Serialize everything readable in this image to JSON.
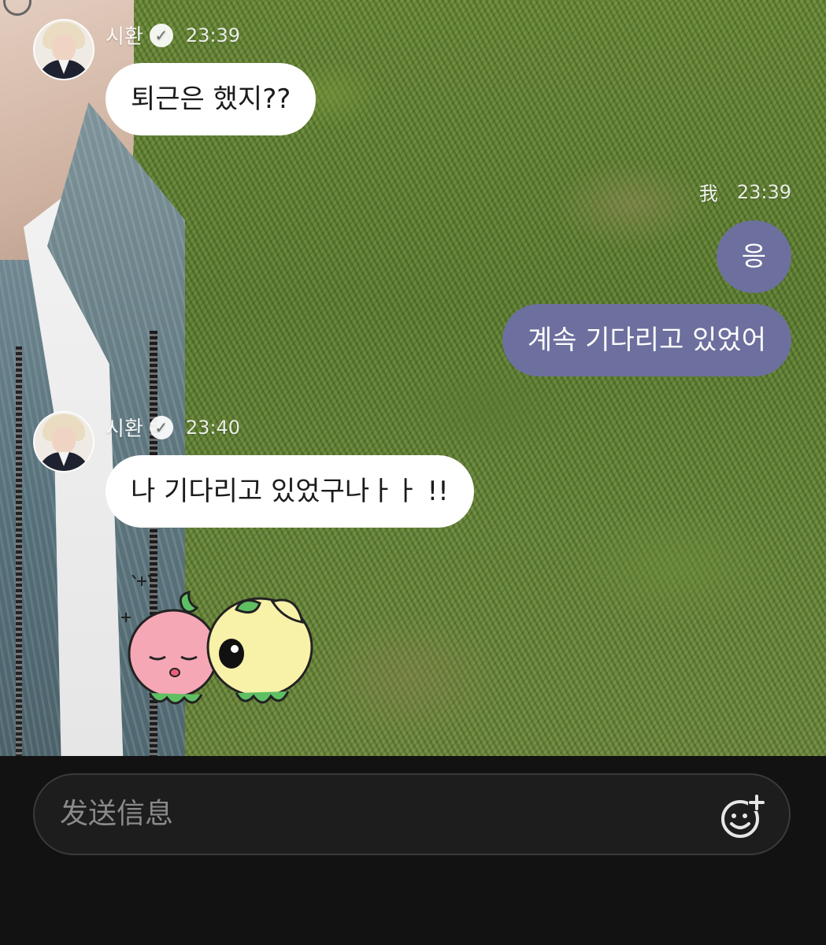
{
  "chat": {
    "messages": [
      {
        "sender": "시환",
        "time": "23:39",
        "text": "퇴근은 했지??"
      },
      {
        "sender": "我",
        "time": "23:39",
        "texts": [
          "응",
          "계속 기다리고 있었어"
        ]
      },
      {
        "sender": "시환",
        "time": "23:40",
        "text": "나 기다리고 있었구나ㅏㅏ !!"
      }
    ],
    "verified_icon": "verified-check-icon",
    "sticker": "strawberry-and-puppy-sticker"
  },
  "composer": {
    "placeholder": "发送信息",
    "emoji_icon": "emoji-add-icon"
  },
  "colors": {
    "outgoing_bubble": "#6d6f9e",
    "incoming_bubble": "#ffffff",
    "footer_bg": "#121212"
  }
}
